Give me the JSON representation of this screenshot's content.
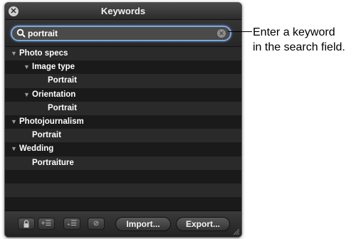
{
  "window": {
    "title": "Keywords"
  },
  "search": {
    "value": "portrait"
  },
  "keywords": [
    {
      "label": "Photo specs"
    },
    {
      "label": "Image type"
    },
    {
      "label": "Portrait"
    },
    {
      "label": "Orientation"
    },
    {
      "label": "Portrait"
    },
    {
      "label": "Photojournalism"
    },
    {
      "label": "Portrait"
    },
    {
      "label": "Wedding"
    },
    {
      "label": "Portraiture"
    }
  ],
  "buttons": {
    "import": "Import...",
    "export": "Export..."
  },
  "icons": {
    "close": "close-icon",
    "search": "search-icon",
    "clear": "clear-icon",
    "disclosure": "disclosure-triangle-icon",
    "lock": "lock-icon",
    "add_keyword": "add-keyword-icon",
    "add_subkeyword": "add-subkeyword-icon",
    "remove": "remove-icon",
    "resize": "resize-grip-icon"
  },
  "callout": {
    "line1": "Enter a keyword",
    "line2": "in the search field."
  },
  "colors": {
    "panel_bg": "#1c1c1c",
    "search_focus": "#7ea7d8"
  }
}
